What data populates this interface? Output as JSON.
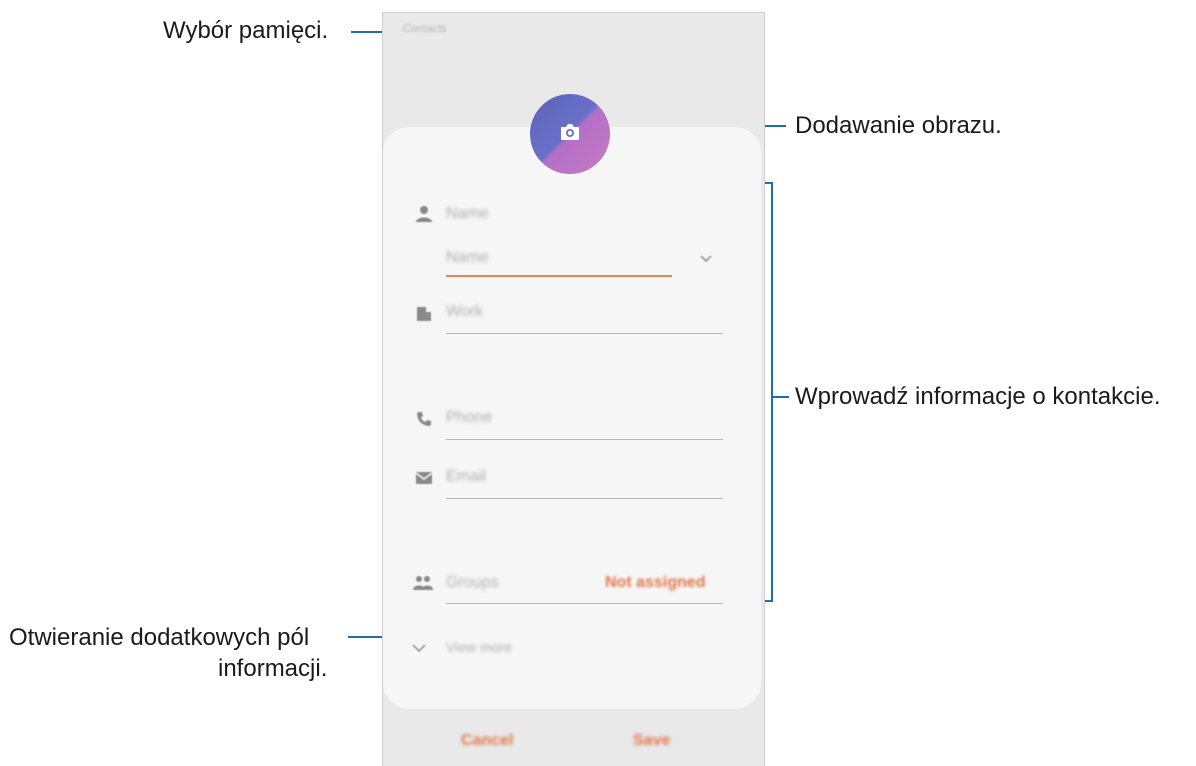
{
  "callouts": {
    "storage": "Wybór pamięci.",
    "add_image": "Dodawanie obrazu.",
    "enter_info": "Wprowadź informacje o kontakcie.",
    "more_fields_line1": "Otwieranie dodatkowych pól",
    "more_fields_line2": "informacji."
  },
  "phone": {
    "storage_label": "Contacts",
    "fields": {
      "name_header": "Name",
      "name_input_placeholder": "Name",
      "work_placeholder": "Work",
      "phone_placeholder": "Phone",
      "email_placeholder": "Email",
      "groups_label": "Groups",
      "groups_value": "Not assigned",
      "view_more": "View more"
    },
    "buttons": {
      "cancel": "Cancel",
      "save": "Save"
    }
  },
  "colors": {
    "callout_line": "#1e6fa8",
    "accent": "#e0764a",
    "avatar_gradient_start": "#5a63b8",
    "avatar_gradient_end": "#c67bc0"
  },
  "icons": [
    "camera-icon",
    "person-icon",
    "building-icon",
    "phone-icon",
    "email-icon",
    "group-icon",
    "chevron-down-icon"
  ]
}
